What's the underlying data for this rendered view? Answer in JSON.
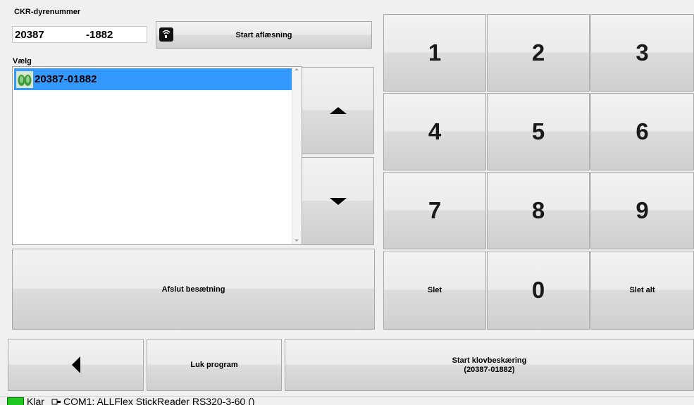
{
  "ckr": {
    "label": "CKR-dyrenummer",
    "herd_value": "20387",
    "animal_value": "-1882"
  },
  "reader": {
    "start_label": "Start aflæsning"
  },
  "select": {
    "label": "Vælg",
    "items": [
      {
        "text": "20387-01882",
        "selected": true
      }
    ]
  },
  "keypad": {
    "keys": [
      "1",
      "2",
      "3",
      "4",
      "5",
      "6",
      "7",
      "8",
      "9",
      "Slet",
      "0",
      "Slet alt"
    ]
  },
  "finish_label": "Afslut besætning",
  "bottom": {
    "close_label": "Luk program",
    "start_trim_label": "Start klovbeskæring",
    "start_trim_sub": "(20387-01882)"
  },
  "status": {
    "state": "Klar",
    "port": "COM1: ALLFlex StickReader RS320-3-60 ()",
    "colors": {
      "ready": "#1ec81e",
      "selection": "#3399ff"
    }
  }
}
